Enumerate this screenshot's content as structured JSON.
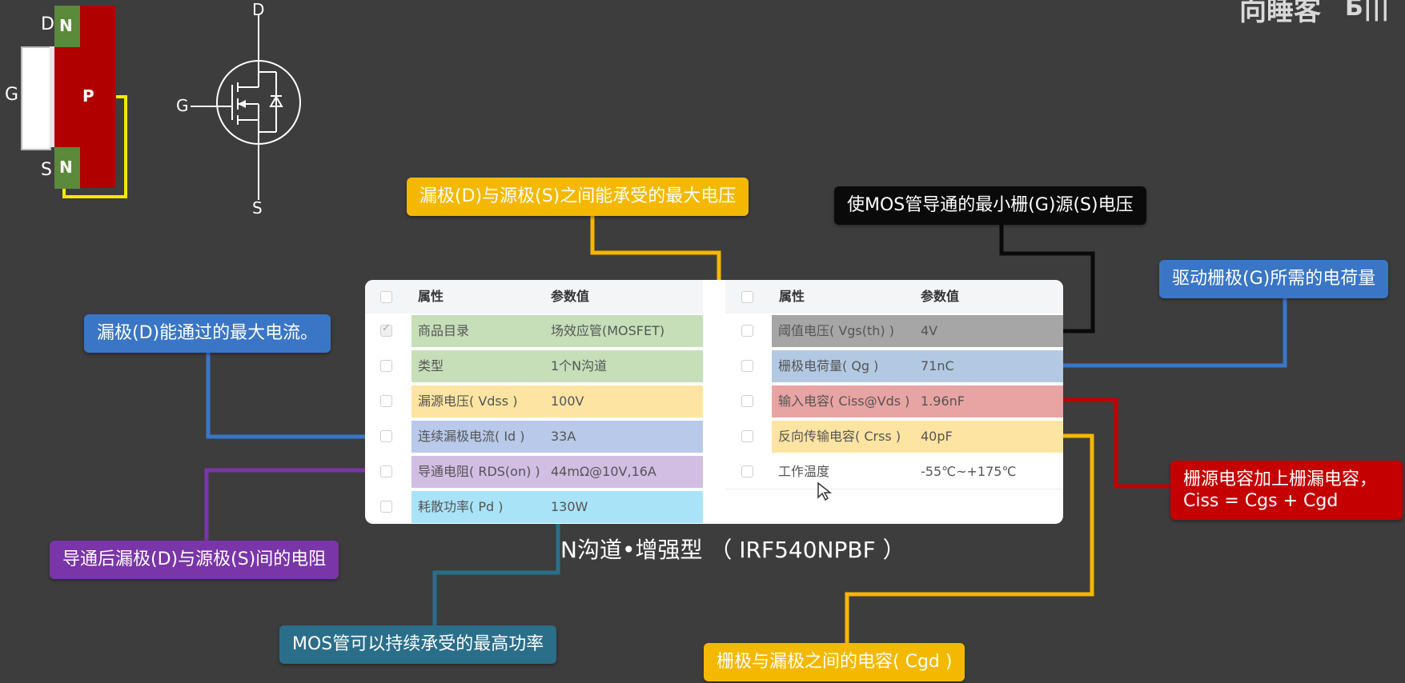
{
  "watermark": {
    "text": "向睡客"
  },
  "structure": {
    "d": "D",
    "g": "G",
    "s": "S",
    "n_top": "N",
    "n_bottom": "N",
    "p": "P"
  },
  "symbol": {
    "d": "D",
    "g": "G",
    "s": "S"
  },
  "left_table": {
    "headers": {
      "attr": "属性",
      "value": "参数值"
    },
    "rows": [
      {
        "attr": "商品目录",
        "value": "场效应管(MOSFET)",
        "color": "#c6dfb9",
        "checked": true
      },
      {
        "attr": "类型",
        "value": "1个N沟道",
        "color": "#c6dfb9",
        "checked": false
      },
      {
        "attr": "漏源电压( Vdss )",
        "value": "100V",
        "color": "#fde4a2",
        "checked": false
      },
      {
        "attr": "连续漏极电流( Id )",
        "value": "33A",
        "color": "#b8c9ea",
        "checked": false
      },
      {
        "attr": "导通电阻( RDS(on) )",
        "value": "44mΩ@10V,16A",
        "color": "#d2bde3",
        "checked": false
      },
      {
        "attr": "耗散功率( Pd )",
        "value": "130W",
        "color": "#a9e3f7",
        "checked": false
      }
    ]
  },
  "right_table": {
    "headers": {
      "attr": "属性",
      "value": "参数值"
    },
    "rows": [
      {
        "attr": "阈值电压( Vgs(th) )",
        "value": "4V",
        "color": "#a6a6a6"
      },
      {
        "attr": "栅极电荷量( Qg )",
        "value": "71nC",
        "color": "#b3c9e3"
      },
      {
        "attr": "输入电容( Ciss@Vds )",
        "value": "1.96nF",
        "color": "#e8a3a3"
      },
      {
        "attr": "反向传输电容( Crss )",
        "value": "40pF",
        "color": "#fde4a2"
      },
      {
        "attr": "工作温度",
        "value": "-55℃~+175℃",
        "color": "#ffffff"
      }
    ]
  },
  "caption": "N沟道•增强型 （ IRF540NPBF ）",
  "callouts": {
    "vdss": "漏极(D)与源极(S)之间能承受的最大电压",
    "vgs": "使MOS管导通的最小栅(G)源(S)电压",
    "qg": "驱动栅极(G)所需的电荷量",
    "id": "漏极(D)能通过的最大电流。",
    "rds": "导通后漏极(D)与源极(S)间的电阻",
    "ciss_line1": "栅源电容加上栅漏电容，",
    "ciss_line2": "Ciss = Cgs + Cgd",
    "pd": "MOS管可以持续承受的最高功率",
    "cgd": "栅极与漏极之间的电容( Cgd )"
  },
  "colors": {
    "background": "#3d3d3d",
    "yellow": "#f5b800",
    "blue": "#3a76c5",
    "purple": "#7a35a8",
    "teal": "#2b6e8a",
    "red": "#c40000",
    "black": "#0a0a0a",
    "p_region": "#b00000",
    "n_region": "#5a8a3a"
  }
}
